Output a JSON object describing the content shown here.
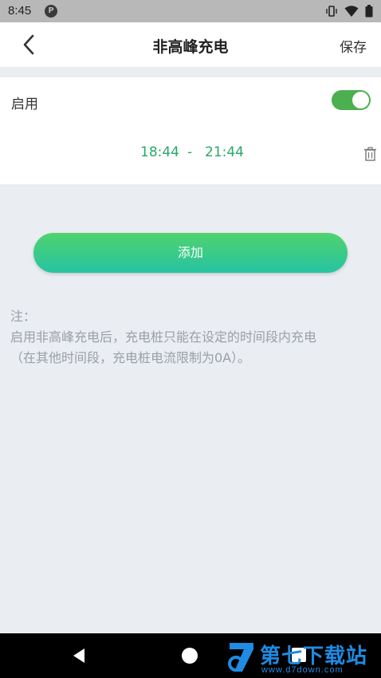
{
  "status_bar": {
    "time": "8:45",
    "app_icon_letter": "P",
    "icons": [
      "vibrate-icon",
      "wifi-icon",
      "battery-icon"
    ]
  },
  "header": {
    "back_icon": "chevron-left-icon",
    "title": "非高峰充电",
    "save_label": "保存"
  },
  "schedule": {
    "enable_label": "启用",
    "enabled": true,
    "toggle_color": "#4caf50",
    "start_time": "18:44",
    "separator": "-",
    "end_time": "21:44",
    "time_color": "#2aa866",
    "delete_icon": "trash-icon"
  },
  "add_button": {
    "label": "添加",
    "gradient": [
      "#4fd36d",
      "#27c3a3"
    ]
  },
  "note": {
    "title": "注：",
    "line1": "启用非高峰充电后，充电桩只能在设定的时间段内充电",
    "line2": "（在其他时间段，充电桩电流限制为0A）。"
  },
  "nav_bar": {
    "icons": [
      "back-triangle-icon",
      "home-circle-icon",
      "recents-square-icon"
    ]
  },
  "watermark": {
    "name": "第七下载站",
    "url": "www.d7down.com",
    "color": "#1f8be3"
  }
}
